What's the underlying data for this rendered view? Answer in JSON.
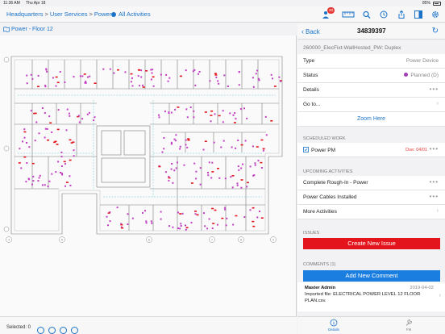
{
  "statusbar": {
    "time": "11:36 AM",
    "date": "Thu Apr 18",
    "battery": "85%"
  },
  "topbar": {
    "breadcrumb": [
      "Headquarters",
      "User Services",
      "Power"
    ],
    "activities_label": "All Activities",
    "badge_count": "33"
  },
  "plan": {
    "title": "Power - Floor 12"
  },
  "selection": {
    "label": "Selected: 0"
  },
  "panel": {
    "back_label": "Back",
    "asset_id": "34839397",
    "subtitle": "260000_ElecFixt-WallHosted_PW: Duplex",
    "type_label": "Type",
    "type_value": "Power Device",
    "status_label": "Status",
    "status_value": "Planned (D)",
    "details_label": "Details",
    "goto_label": "Go to...",
    "zoom_label": "Zoom Here",
    "scheduled_header": "Scheduled Work",
    "scheduled_item": "Power PM",
    "scheduled_due": "Due: 04/01",
    "upcoming_header": "Upcoming Activities",
    "upcoming": [
      "Complete Rough-In - Power",
      "Power Cables Installed",
      "More Activities"
    ],
    "issues_header": "Issues",
    "create_issue": "Create New Issue",
    "comments_header": "Comments (1)",
    "add_comment": "Add New Comment",
    "comment": {
      "author": "Master Admin",
      "date": "2019-04-02",
      "text": "Imported file: ELECTRICAL POWER LEVEL 12 FLOOR PLAN.csv."
    },
    "tabs": [
      {
        "label": "Details",
        "icon": "info-icon",
        "active": true
      },
      {
        "label": "PM",
        "icon": "wrench-icon",
        "active": false
      }
    ]
  },
  "colors": {
    "accent": "#1a73c9",
    "danger": "#e3141b",
    "status_planned": "#a03cb4"
  }
}
